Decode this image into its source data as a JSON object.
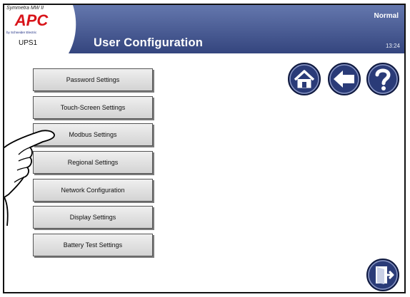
{
  "header": {
    "product": "Symmetra MW II",
    "brand": "APC",
    "maker": "by Schneider Electric",
    "device": "UPS1",
    "title": "User Configuration",
    "status": "Normal",
    "time": "13:24"
  },
  "menu": {
    "items": [
      {
        "label": "Password Settings"
      },
      {
        "label": "Touch-Screen Settings"
      },
      {
        "label": "Modbus Settings"
      },
      {
        "label": "Regional Settings"
      },
      {
        "label": "Network Configuration"
      },
      {
        "label": "Display Settings"
      },
      {
        "label": "Battery Test Settings"
      }
    ]
  },
  "nav_icons": {
    "home": "home-icon",
    "back": "back-arrow-icon",
    "help": "help-icon",
    "exit": "exit-door-icon"
  },
  "colors": {
    "header_blue": "#4a5f99",
    "header_dark": "#2d3d72",
    "brand_red": "#d8141a",
    "button_blue": "#2a3b78"
  }
}
